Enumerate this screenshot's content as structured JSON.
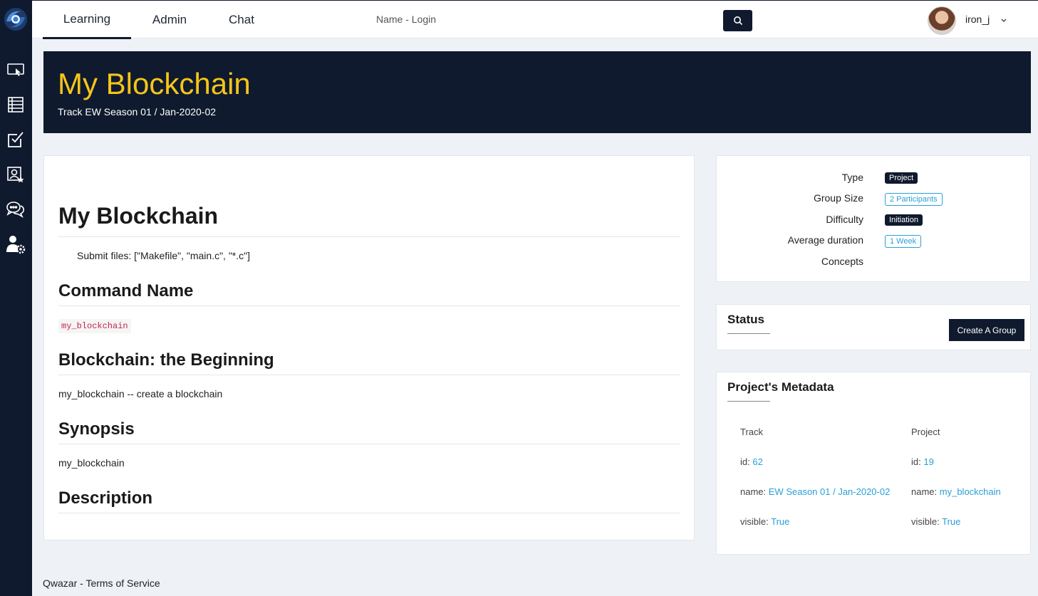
{
  "nav": {
    "tabs": [
      {
        "label": "Learning",
        "active": true
      },
      {
        "label": "Admin",
        "active": false
      },
      {
        "label": "Chat",
        "active": false
      }
    ],
    "login_text": "Name - Login",
    "username": "iron_j"
  },
  "sidebar": {
    "items": [
      {
        "icon": "screen-cursor-icon"
      },
      {
        "icon": "list-icon"
      },
      {
        "icon": "checkbox-icon"
      },
      {
        "icon": "user-star-icon"
      },
      {
        "icon": "chat-icon"
      },
      {
        "icon": "user-settings-icon"
      }
    ]
  },
  "banner": {
    "title": "My Blockchain",
    "subtitle": "Track EW Season 01 / Jan-2020-02"
  },
  "content": {
    "title": "My Blockchain",
    "submit_files": "Submit files: [\"Makefile\", \"main.c\", \"*.c\"]",
    "command_heading": "Command Name",
    "command_code": "my_blockchain",
    "beginning_heading": "Blockchain: the Beginning",
    "beginning_text": "my_blockchain -- create a blockchain",
    "synopsis_heading": "Synopsis",
    "synopsis_text": "my_blockchain",
    "description_heading": "Description"
  },
  "info": {
    "type_label": "Type",
    "type_value": "Project",
    "group_label": "Group Size",
    "group_value": "2 Participants",
    "difficulty_label": "Difficulty",
    "difficulty_value": "Initiation",
    "duration_label": "Average duration",
    "duration_value": "1 Week",
    "concepts_label": "Concepts"
  },
  "status": {
    "title": "Status",
    "create_group_label": "Create A Group"
  },
  "metadata": {
    "title": "Project's Metadata",
    "track": {
      "heading": "Track",
      "id_label": "id:",
      "id": "62",
      "name_label": "name:",
      "name": "EW Season 01 / Jan-2020-02",
      "visible_label": "visible:",
      "visible": "True"
    },
    "project": {
      "heading": "Project",
      "id_label": "id:",
      "id": "19",
      "name_label": "name:",
      "name": "my_blockchain",
      "visible_label": "visible:",
      "visible": "True"
    }
  },
  "footer": {
    "brand": "Qwazar",
    "separator": " - ",
    "terms": "Terms of Service"
  },
  "colors": {
    "navy": "#0f1a2e",
    "accent_yellow": "#f5c518",
    "link_blue": "#2a9fd6",
    "code_pink": "#c7254e"
  }
}
